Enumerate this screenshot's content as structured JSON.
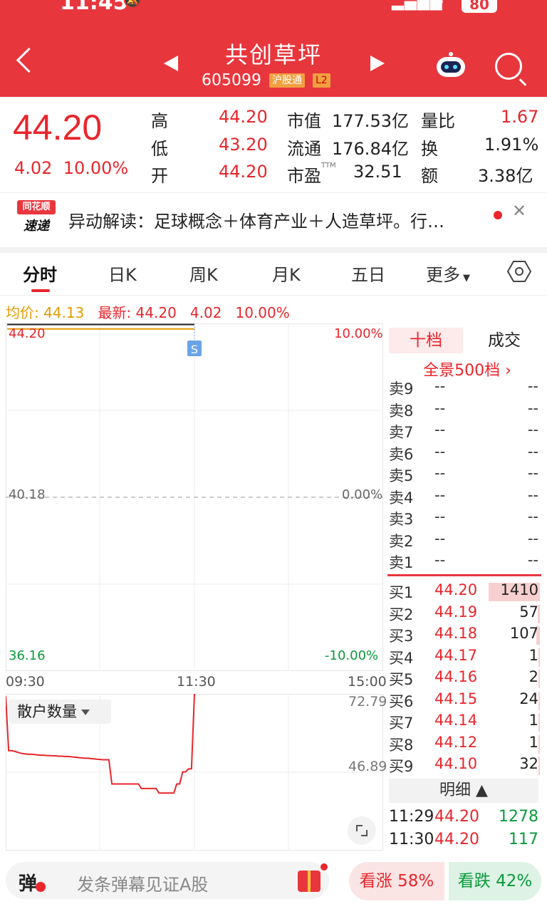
{
  "status_bar": {
    "time": "11:45",
    "battery": "80"
  },
  "header": {
    "title": "共创草坪",
    "code": "605099",
    "tag1": "沪股通",
    "tag2": "L2"
  },
  "quote": {
    "price": "44.20",
    "change": "4.02",
    "change_pct": "10.00%",
    "high_label": "高",
    "high": "44.20",
    "low_label": "低",
    "low": "43.20",
    "open_label": "开",
    "open": "44.20",
    "mcap_label": "市值",
    "mcap": "177.53亿",
    "float_label": "流通",
    "float": "176.84亿",
    "pe_label": "市盈",
    "pe_sup": "TTM",
    "pe": "32.51",
    "vr_label": "量比",
    "vr": "1.67",
    "turn_label": "换",
    "turn": "1.91%",
    "amt_label": "额",
    "amt": "3.38亿"
  },
  "news": {
    "logo_top": "同花顺",
    "logo_bottom": "速递",
    "text": "异动解读：足球概念＋体育产业＋人造草坪。行…"
  },
  "tabs": [
    "分时",
    "日K",
    "周K",
    "月K",
    "五日",
    "更多"
  ],
  "chart_header": {
    "avg_label": "均价: 44.13",
    "latest_label": "最新: 44.20",
    "change": "4.02",
    "pct": "10.00%"
  },
  "chart_data": {
    "type": "line",
    "price_axis": {
      "top": "44.20",
      "mid": "40.18",
      "bottom": "36.16"
    },
    "pct_axis": {
      "top": "10.00%",
      "mid": "0.00%",
      "bottom": "-10.00%"
    },
    "x_ticks": [
      "09:30",
      "11:30",
      "15:00"
    ],
    "ylim": [
      36.16,
      44.2
    ],
    "marker": "S",
    "series": [
      {
        "name": "最新",
        "x": [
          "09:30",
          "11:30"
        ],
        "values": [
          44.2,
          44.2
        ]
      },
      {
        "name": "均价",
        "x": [
          "09:30",
          "11:30"
        ],
        "values": [
          44.13,
          44.13
        ]
      }
    ]
  },
  "lower_chart": {
    "selector": "散户数量",
    "y_top": "72.79",
    "y_mid": "46.89",
    "ylim": [
      20.99,
      72.79
    ],
    "values": [
      72.0,
      54.0,
      54.0,
      53.8,
      53.5,
      53.2,
      53.0,
      52.9,
      52.8,
      52.8,
      52.7,
      52.6,
      52.5,
      52.5,
      52.4,
      52.4,
      52.3,
      52.3,
      52.2,
      52.2,
      52.1,
      52.1,
      52.0,
      51.9,
      51.8,
      51.7,
      51.6,
      51.5,
      51.5,
      51.4,
      51.3,
      51.2,
      51.1,
      51.0,
      51.0,
      51.0,
      43.0,
      43.0,
      43.0,
      43.0,
      43.0,
      43.0,
      43.0,
      43.0,
      43.0,
      43.0,
      41.5,
      41.5,
      41.5,
      41.5,
      41.5,
      41.5,
      40.0,
      40.0,
      40.0,
      40.0,
      40.0,
      40.0,
      43.0,
      43.0,
      47.0,
      47.0,
      48.0,
      48.0,
      72.79
    ]
  },
  "orderbook": {
    "tab_on": "十档",
    "tab_off": "成交",
    "full": "全景500档 ›",
    "asks": [
      {
        "n": "卖9",
        "p": "--",
        "v": "--"
      },
      {
        "n": "卖8",
        "p": "--",
        "v": "--"
      },
      {
        "n": "卖7",
        "p": "--",
        "v": "--"
      },
      {
        "n": "卖6",
        "p": "--",
        "v": "--"
      },
      {
        "n": "卖5",
        "p": "--",
        "v": "--"
      },
      {
        "n": "卖4",
        "p": "--",
        "v": "--"
      },
      {
        "n": "卖3",
        "p": "--",
        "v": "--"
      },
      {
        "n": "卖2",
        "p": "--",
        "v": "--"
      },
      {
        "n": "卖1",
        "p": "--",
        "v": "--"
      }
    ],
    "bids": [
      {
        "n": "买1",
        "p": "44.20",
        "v": "1410"
      },
      {
        "n": "买2",
        "p": "44.19",
        "v": "57"
      },
      {
        "n": "买3",
        "p": "44.18",
        "v": "107"
      },
      {
        "n": "买4",
        "p": "44.17",
        "v": "1"
      },
      {
        "n": "买5",
        "p": "44.16",
        "v": "2"
      },
      {
        "n": "买6",
        "p": "44.15",
        "v": "24"
      },
      {
        "n": "买7",
        "p": "44.14",
        "v": "1"
      },
      {
        "n": "买8",
        "p": "44.12",
        "v": "1"
      },
      {
        "n": "买9",
        "p": "44.10",
        "v": "32"
      }
    ],
    "detail_label": "明细 ▲",
    "trades": [
      {
        "t": "11:29",
        "p": "44.20",
        "v": "1278"
      },
      {
        "t": "11:30",
        "p": "44.20",
        "v": "117"
      }
    ]
  },
  "bottom": {
    "danmu_icon": "弹",
    "placeholder": "发条弹幕见证A股",
    "up": "看涨 58%",
    "down": "看跌 42%"
  },
  "colors": {
    "brand": "#e8363d",
    "up": "#e8262c",
    "down": "#0a9a3c",
    "avg": "#e39a00"
  }
}
